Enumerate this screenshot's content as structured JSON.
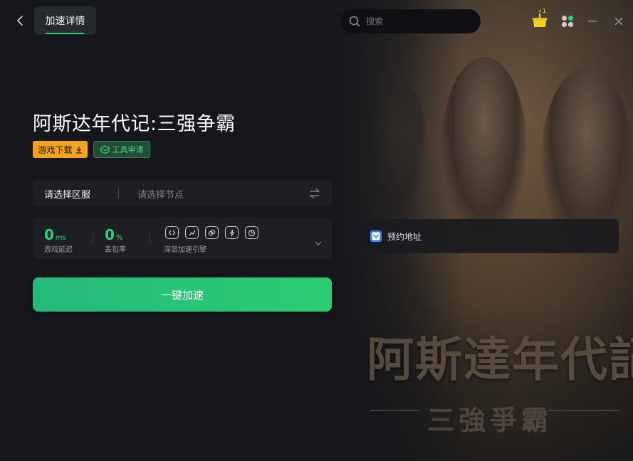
{
  "header": {
    "active_tab": "加速详情",
    "search_placeholder": "搜索",
    "gift_badge": "+1"
  },
  "game": {
    "title": "阿斯达年代记:三强争霸",
    "download_tag": "游戏下载",
    "tool_tag": "工具申请"
  },
  "server": {
    "region_label": "请选择区服",
    "node_placeholder": "请选择节点"
  },
  "stats": {
    "latency_value": "0",
    "latency_unit": "ms",
    "latency_label": "游戏延迟",
    "loss_value": "0",
    "loss_unit": "%",
    "loss_label": "丢包率",
    "engine_label": "深层加速引擎"
  },
  "accelerate_button": "一键加速",
  "reserve": {
    "label": "预约地址"
  },
  "art": {
    "title": "阿斯達年代記",
    "subtitle": "三強爭霸"
  },
  "colors": {
    "accent_green": "#2bcf78",
    "download_orange": "#f7a21b",
    "background": "#15171c"
  }
}
